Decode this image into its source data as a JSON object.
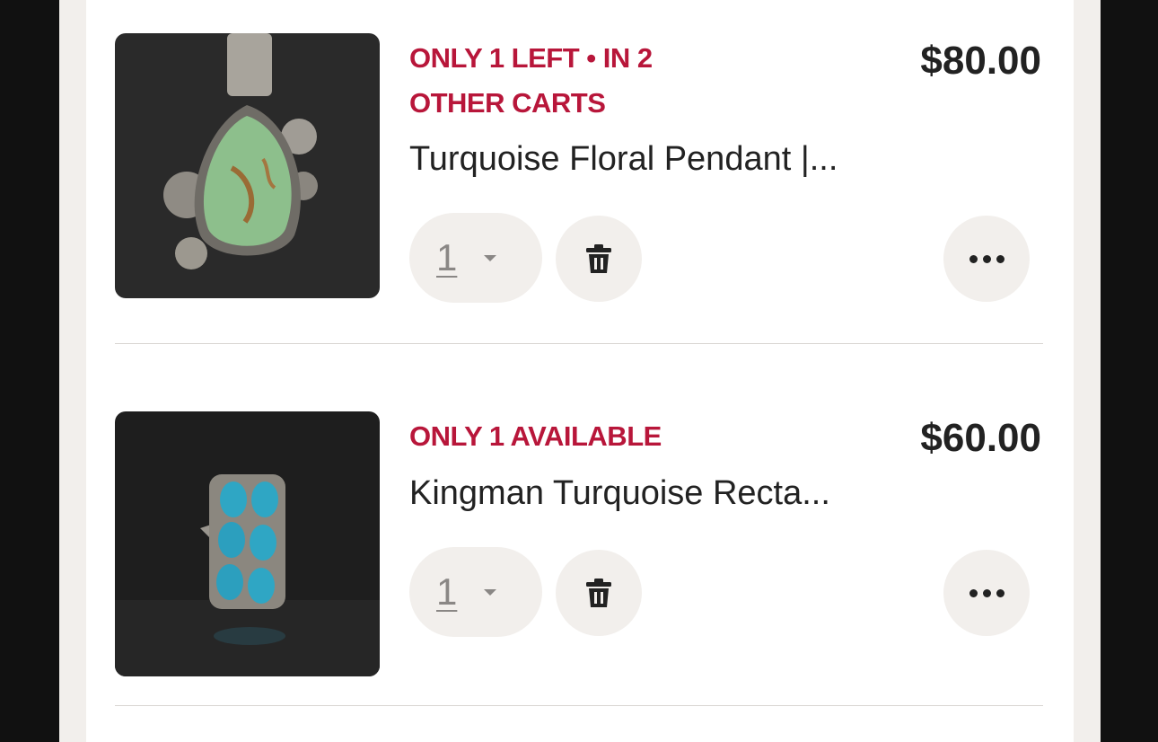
{
  "cart_items": [
    {
      "urgency": "ONLY 1 LEFT • IN 2 OTHER CARTS",
      "price": "$80.00",
      "title": "Turquoise Floral Pendant |...",
      "quantity": "1",
      "image": "turquoise-floral-pendant-photo"
    },
    {
      "urgency": "ONLY 1 AVAILABLE",
      "price": "$60.00",
      "title": "Kingman Turquoise Recta...",
      "quantity": "1",
      "image": "kingman-turquoise-ring-photo"
    }
  ],
  "icons": {
    "remove": "trash-icon",
    "more": "more-options-icon",
    "quantity_dropdown": "caret-down-icon"
  },
  "colors": {
    "urgency": "#b8163a",
    "text": "#222222",
    "button_bg": "#f2efec"
  }
}
